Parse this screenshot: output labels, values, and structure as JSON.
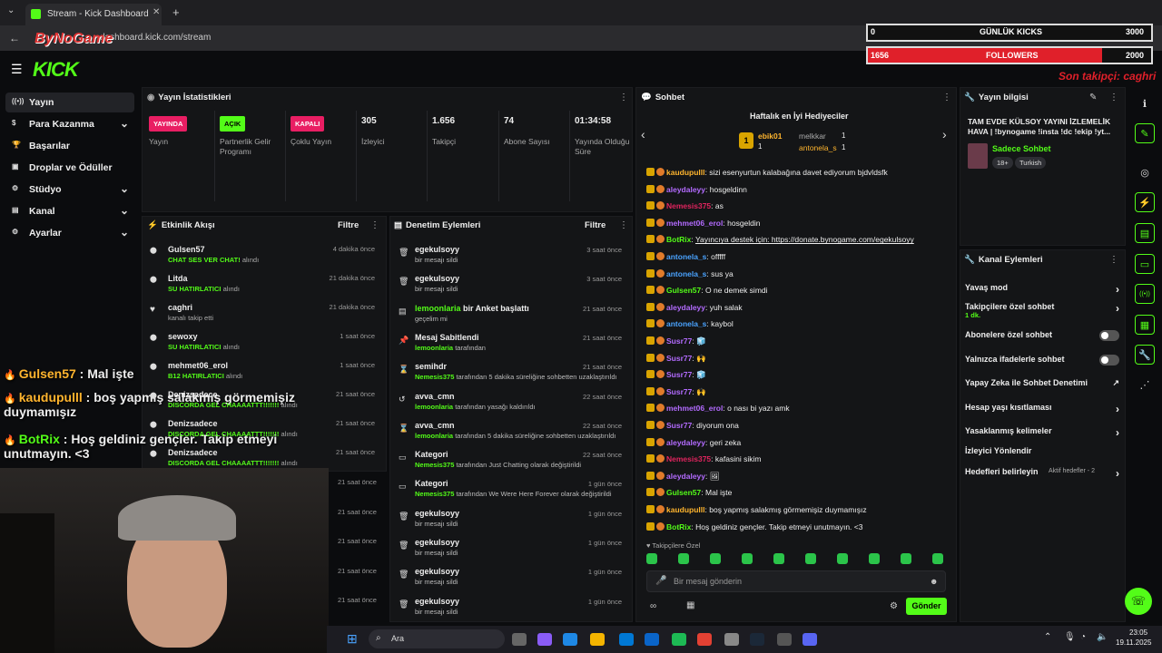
{
  "browser": {
    "tab_title": "Stream - Kick Dashboard",
    "url": "dashboard.kick.com/stream",
    "new_tab": "+",
    "close": "✕"
  },
  "brand": {
    "logo": "KICK",
    "accent": "#53fc18"
  },
  "sidebar": {
    "items": [
      {
        "label": "Yayın",
        "icon": "broadcast-icon"
      },
      {
        "label": "Para Kazanma",
        "icon": "money-icon",
        "chev": true
      },
      {
        "label": "Başarılar",
        "icon": "trophy-icon"
      },
      {
        "label": "Droplar ve Ödüller",
        "icon": "gift-icon"
      },
      {
        "label": "Stüdyo",
        "icon": "studio-icon",
        "chev": true
      },
      {
        "label": "Kanal",
        "icon": "channel-icon",
        "chev": true
      },
      {
        "label": "Ayarlar",
        "icon": "gear-icon",
        "chev": true
      }
    ]
  },
  "stats": {
    "title": "Yayın İstatistikleri",
    "items": [
      {
        "badge": "YAYINDA",
        "label": "Yayın",
        "color": "#e91e63"
      },
      {
        "badge": "AÇIK",
        "label": "Partnerlik Gelir Programı",
        "color": "#53fc18"
      },
      {
        "badge": "KAPALI",
        "label": "Çoklu Yayın",
        "color": "#e91e63"
      },
      {
        "value": "305",
        "label": "İzleyici"
      },
      {
        "value": "1.656",
        "label": "Takipçi"
      },
      {
        "value": "74",
        "label": "Abone Sayısı"
      },
      {
        "value": "01:34:58",
        "label": "Yayında Olduğu Süre"
      }
    ]
  },
  "activity": {
    "title": "Etkinlik Akışı",
    "filter": "Filtre",
    "rows": [
      {
        "name": "Gulsen57",
        "sub": "CHAT SES VER CHAT!",
        "suffix": "alındı",
        "time": "4 dakika önce"
      },
      {
        "name": "Litda",
        "sub": "SU HATIRLATICI",
        "suffix": "alındı",
        "time": "21 dakika önce"
      },
      {
        "name": "caghri",
        "sub": "",
        "suffix": "kanalı takip etti",
        "time": "21 dakika önce"
      },
      {
        "name": "sewoxy",
        "sub": "SU HATIRLATICI",
        "suffix": "alındı",
        "time": "1 saat önce"
      },
      {
        "name": "mehmet06_erol",
        "sub": "B12 HATIRLATICI",
        "suffix": "alındı",
        "time": "1 saat önce"
      },
      {
        "name": "Denizsadece",
        "sub": "DISCORDA GEL CHAAAATTT!!!!!!!",
        "suffix": "alındı",
        "time": "21 saat önce"
      },
      {
        "name": "Denizsadece",
        "sub": "DISCORDA GEL CHAAAATTT!!!!!!!",
        "suffix": "alındı",
        "time": "21 saat önce"
      },
      {
        "name": "Denizsadece",
        "sub": "DISCORDA GEL CHAAAATTT!!!!!!!",
        "suffix": "alındı",
        "time": "21 saat önce"
      }
    ],
    "times_extra": [
      "21 saat önce",
      "21 saat önce",
      "21 saat önce",
      "21 saat önce",
      "21 saat önce"
    ]
  },
  "moderation": {
    "title": "Denetim Eylemleri",
    "filter": "Filtre",
    "rows": [
      {
        "icon": "trash-icon",
        "name": "egekulsoyy",
        "action": "",
        "sub": "bir mesajı sildi",
        "time": "3 saat önce"
      },
      {
        "icon": "trash-icon",
        "name": "egekulsoyy",
        "action": "",
        "sub": "bir mesajı sildi",
        "time": "3 saat önce"
      },
      {
        "icon": "poll-icon",
        "name": "lemoonlaria",
        "action": " bir Anket başlattı",
        "sub": "geçelim mi",
        "time": "21 saat önce"
      },
      {
        "icon": "pin-icon",
        "name": "Mesaj Sabitlendi",
        "action": "",
        "sub_g": "lemoonlaria",
        "sub": " tarafından",
        "time": "21 saat önce"
      },
      {
        "icon": "hourglass-icon",
        "name": "semihdr",
        "action": "",
        "sub_g": "Nemesis375",
        "sub": " tarafından 5 dakika süreliğine sohbetten uzaklaştırıldı",
        "time": "21 saat önce"
      },
      {
        "icon": "undo-icon",
        "name": "avva_cmn",
        "action": "",
        "sub_g": "lemoonlaria",
        "sub": " tarafından yasağı kaldırıldı",
        "time": "22 saat önce"
      },
      {
        "icon": "hourglass-icon",
        "name": "avva_cmn",
        "action": "",
        "sub_g": "lemoonlaria",
        "sub": " tarafından 5 dakika süreliğine sohbetten uzaklaştırıldı",
        "time": "22 saat önce"
      },
      {
        "icon": "category-icon",
        "name": "Kategori",
        "action": "",
        "sub_g": "Nemesis375",
        "sub": " tarafından Just Chatting olarak değiştirildi",
        "time": "22 saat önce"
      },
      {
        "icon": "category-icon",
        "name": "Kategori",
        "action": "",
        "sub_g": "Nemesis375",
        "sub": " tarafından We Were Here Forever olarak değiştirildi",
        "time": "1 gün önce"
      },
      {
        "icon": "trash-icon",
        "name": "egekulsoyy",
        "action": "",
        "sub": "bir mesajı sildi",
        "time": "1 gün önce"
      },
      {
        "icon": "trash-icon",
        "name": "egekulsoyy",
        "action": "",
        "sub": "bir mesajı sildi",
        "time": "1 gün önce"
      },
      {
        "icon": "trash-icon",
        "name": "egekulsoyy",
        "action": "",
        "sub": "bir mesajı sildi",
        "time": "1 gün önce"
      },
      {
        "icon": "trash-icon",
        "name": "egekulsoyy",
        "action": "",
        "sub": "bir mesajı sildi",
        "time": "1 gün önce"
      }
    ]
  },
  "chat": {
    "title": "Sohbet",
    "gifters_title": "Haftalık en İyi Hediyeciler",
    "gifters": [
      {
        "name": "ebik01",
        "count": "1"
      },
      {
        "name": "melkkar",
        "count": "1"
      },
      {
        "name": "antonela_s",
        "count": "1"
      }
    ],
    "messages": [
      {
        "user": "kaudupulll",
        "color": "#ffb52e",
        "text": "sizi esenyurtun kalabağına davet ediyorum bjdvldsfk"
      },
      {
        "user": "aleydaleyy",
        "color": "#b36bff",
        "text": "hosgeldinn"
      },
      {
        "user": "Nemesis375",
        "color": "#e0245e",
        "text": "as"
      },
      {
        "user": "mehmet06_erol",
        "color": "#b36bff",
        "text": "hosgeldin"
      },
      {
        "user": "BotRix",
        "color": "#53fc18",
        "text": "Yayıncıya destek için: https://donate.bynogame.com/egekulsoyy"
      },
      {
        "user": "antonela_s",
        "color": "#4aa3ff",
        "text": "offfff"
      },
      {
        "user": "antonela_s",
        "color": "#4aa3ff",
        "text": "sus ya"
      },
      {
        "user": "Gulsen57",
        "color": "#53fc18",
        "text": "O ne demek simdi"
      },
      {
        "user": "aleydaleyy",
        "color": "#b36bff",
        "text": "yuh salak"
      },
      {
        "user": "antonela_s",
        "color": "#4aa3ff",
        "text": "kaybol"
      },
      {
        "user": "Susr77",
        "color": "#b36bff",
        "text": "🧊"
      },
      {
        "user": "Susr77",
        "color": "#b36bff",
        "text": "🙌"
      },
      {
        "user": "Susr77",
        "color": "#b36bff",
        "text": "🧊"
      },
      {
        "user": "Susr77",
        "color": "#b36bff",
        "text": "🙌"
      },
      {
        "user": "mehmet06_erol",
        "color": "#b36bff",
        "text": "o nası bi yazı amk"
      },
      {
        "user": "Susr77",
        "color": "#b36bff",
        "text": "diyorum ona"
      },
      {
        "user": "aleydaleyy",
        "color": "#b36bff",
        "text": "geri zeka"
      },
      {
        "user": "Nemesis375",
        "color": "#e0245e",
        "text": "kafasini sikim"
      },
      {
        "user": "aleydaleyy",
        "color": "#b36bff",
        "text": "🖼"
      },
      {
        "user": "Gulsen57",
        "color": "#53fc18",
        "text": "Mal işte"
      },
      {
        "user": "kaudupulll",
        "color": "#ffb52e",
        "text": "boş yapmış salakmış görmemişiz duymamışız"
      },
      {
        "user": "BotRix",
        "color": "#53fc18",
        "text": "Hoş geldiniz gençler. Takip etmeyi unutmayın. <3"
      }
    ],
    "followers_only": "Takipçilere Özel",
    "input_placeholder": "Bir mesaj gönderin",
    "send": "Gönder"
  },
  "stream_info": {
    "title": "Yayın bilgisi",
    "stream_title": "TAM EVDE KÜLSOY YAYINI İZLEMELİK HAVA | !bynogame !insta !dc !ekip !yt...",
    "category": "Sadece Sohbet",
    "tags": [
      "18+",
      "Turkish"
    ]
  },
  "channel_actions": {
    "title": "Kanal Eylemleri",
    "rows": [
      {
        "label": "Yavaş mod",
        "kind": "chev"
      },
      {
        "label": "Takipçilere özel sohbet",
        "sub": "1 dk.",
        "kind": "chev"
      },
      {
        "label": "Abonelere özel sohbet",
        "kind": "toggle"
      },
      {
        "label": "Yalnızca ifadelerle sohbet",
        "kind": "toggle"
      },
      {
        "label": "Yapay Zeka ile Sohbet Denetimi",
        "kind": "ext"
      },
      {
        "label": "Hesap yaşı kısıtlaması",
        "kind": "chev"
      },
      {
        "label": "Yasaklanmış kelimeler",
        "kind": "chev"
      },
      {
        "label": "İzleyici Yönlendir",
        "kind": "none"
      },
      {
        "label": "Hedefleri belirleyin",
        "sub": "Aktif hedefler - 2",
        "kind": "chev"
      }
    ]
  },
  "overlay": {
    "brand": "ByNoGame",
    "kicks_label": "GÜNLÜK KICKS",
    "kicks_current": "0",
    "kicks_goal": "3000",
    "followers_label": "FOLLOWERS",
    "followers_current": "1656",
    "followers_goal": "2000",
    "followers_progress": 0.828,
    "last_follower": "Son takipçi: caghri",
    "chat": [
      {
        "user": "Gulsen57",
        "text": " : Mal işte"
      },
      {
        "user": "kaudupulll",
        "text": " : boş yapmış salakmış görmemişiz duymamışız"
      },
      {
        "user": "BotRix",
        "text": " : Hoş geldiniz gençler. Takip etmeyi unutmayın. <3"
      }
    ]
  },
  "taskbar": {
    "search": "Ara",
    "time": "23:05",
    "date": "19.11.2025"
  }
}
